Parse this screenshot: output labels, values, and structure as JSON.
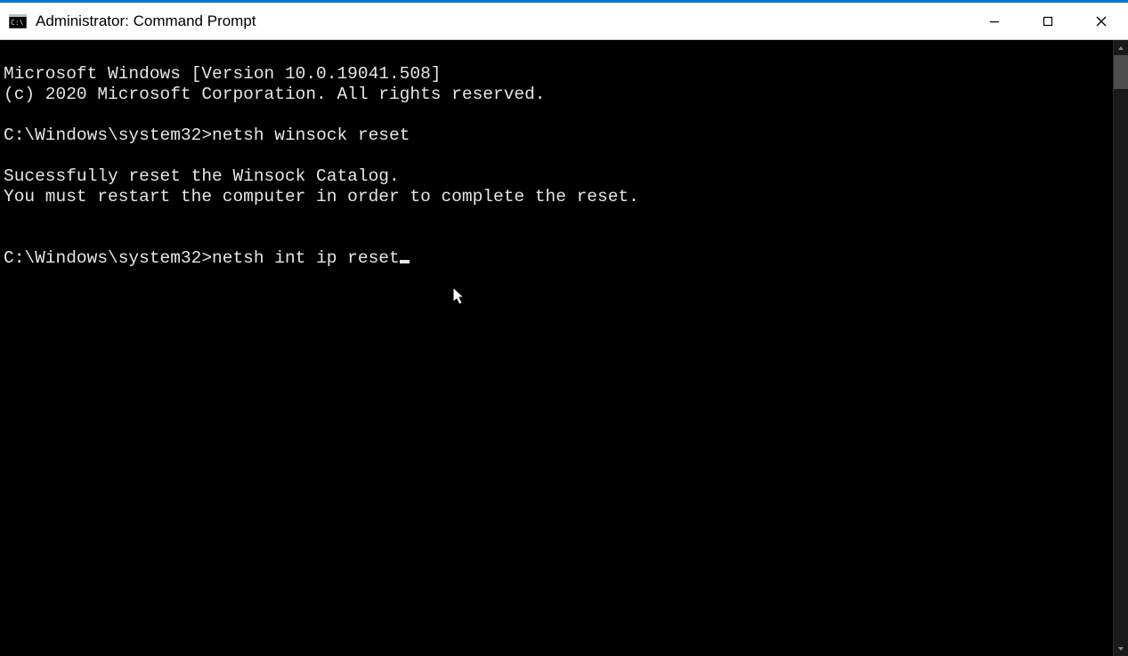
{
  "titlebar": {
    "title": "Administrator: Command Prompt"
  },
  "terminal": {
    "banner_version": "Microsoft Windows [Version 10.0.19041.508]",
    "banner_copyright": "(c) 2020 Microsoft Corporation. All rights reserved.",
    "prompt1": "C:\\Windows\\system32>",
    "command1": "netsh winsock reset",
    "output1_line1": "Sucessfully reset the Winsock Catalog.",
    "output1_line2": "You must restart the computer in order to complete the reset.",
    "prompt2": "C:\\Windows\\system32>",
    "command2": "netsh int ip reset"
  }
}
